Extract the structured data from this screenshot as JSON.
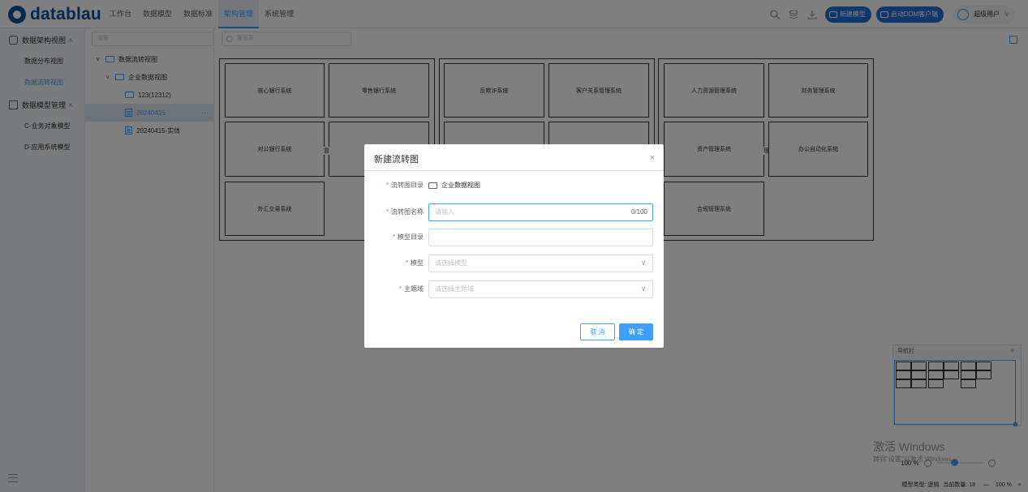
{
  "app": {
    "logo_text": "datablau"
  },
  "nav": {
    "items": [
      {
        "label": "工作台",
        "active": false
      },
      {
        "label": "数据模型",
        "active": false
      },
      {
        "label": "数据标准",
        "active": false
      },
      {
        "label": "架构管理",
        "active": true
      },
      {
        "label": "系统管理",
        "active": false
      }
    ]
  },
  "toolbar": {
    "new_model": "新建模型",
    "launch_ddm": "启动DDM客户端",
    "user": "超级用户"
  },
  "sidebar": {
    "groups": [
      {
        "label": "数据架构视图",
        "items": [
          "数据分布视图",
          "数据流转视图"
        ]
      },
      {
        "label": "数据模型管理",
        "items": [
          "C-业务对象模型",
          "D-应用系统模型"
        ]
      }
    ],
    "active_item": "数据流转视图"
  },
  "tree": {
    "search_placeholder": "搜索",
    "nodes": [
      "数据流转视图",
      "企业数据视图",
      "123(12312)",
      "20240415",
      "20240415-实体"
    ],
    "more": "···"
  },
  "canvas": {
    "search_placeholder": "搜索系",
    "systems": [
      "核心银行系统",
      "零售银行系统",
      "对公银行系统",
      "外汇交易系统",
      "反欺诈系统",
      "客户关系管理系统",
      "人力资源管理系统",
      "财务管理系统",
      "资产管理系统",
      "办公自动化系统",
      "合规管理系统"
    ],
    "partial_chars": [
      "曾",
      "3",
      "理"
    ]
  },
  "navigator": {
    "title": "导航栏",
    "collapse": "«"
  },
  "zoom": {
    "value": "100 %"
  },
  "status": {
    "model_type": "模型类型: 逻辑",
    "count": "当前数量: 18",
    "minus": "—",
    "zoom": "100 %",
    "plus": "+"
  },
  "watermark": {
    "line1": "激活 Windows",
    "line2": "转到\"设置\"以激活 Windows。"
  },
  "dialog": {
    "title": "新建流转图",
    "close": "×",
    "fields": [
      {
        "label": "流转图目录",
        "value": "企业数据视图"
      },
      {
        "label": "流转图名称",
        "placeholder": "请输入",
        "counter": "0/100"
      },
      {
        "label": "模型目录",
        "value": ""
      },
      {
        "label": "模型",
        "placeholder": "请选择模型"
      },
      {
        "label": "主题域",
        "placeholder": "请选择主题域"
      }
    ],
    "required_mark": "*",
    "cancel": "取 消",
    "ok": "确 定"
  }
}
